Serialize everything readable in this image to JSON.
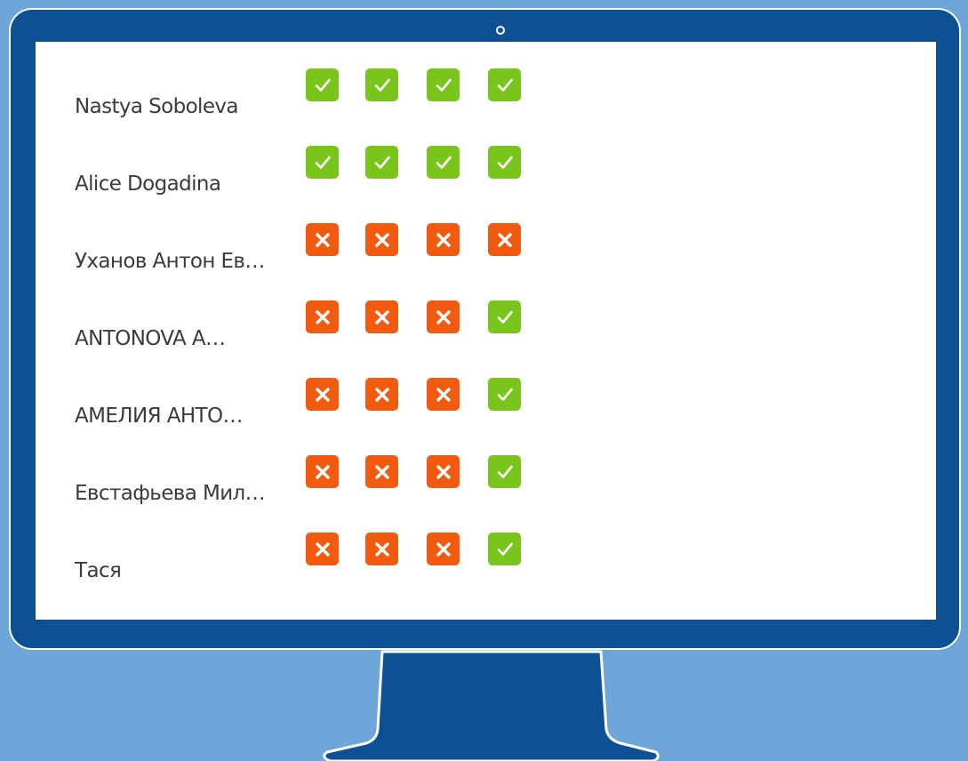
{
  "colors": {
    "background": "#6fa6da",
    "monitor": "#0d5194",
    "check": "#7ac51c",
    "cross": "#f15a0f"
  },
  "rows": [
    {
      "name": "Nastya Soboleva",
      "marks": [
        "check",
        "check",
        "check",
        "check"
      ]
    },
    {
      "name": "Alice Dogadina",
      "marks": [
        "check",
        "check",
        "check",
        "check"
      ]
    },
    {
      "name": "Уханов Антон Ев…",
      "marks": [
        "cross",
        "cross",
        "cross",
        "cross"
      ]
    },
    {
      "name": "ANTONOVA A…",
      "marks": [
        "cross",
        "cross",
        "cross",
        "check"
      ]
    },
    {
      "name": "АМЕЛИЯ АНТО…",
      "marks": [
        "cross",
        "cross",
        "cross",
        "check"
      ]
    },
    {
      "name": "Евстафьева Мил…",
      "marks": [
        "cross",
        "cross",
        "cross",
        "check"
      ]
    },
    {
      "name": "Тася",
      "marks": [
        "cross",
        "cross",
        "cross",
        "check"
      ]
    }
  ]
}
